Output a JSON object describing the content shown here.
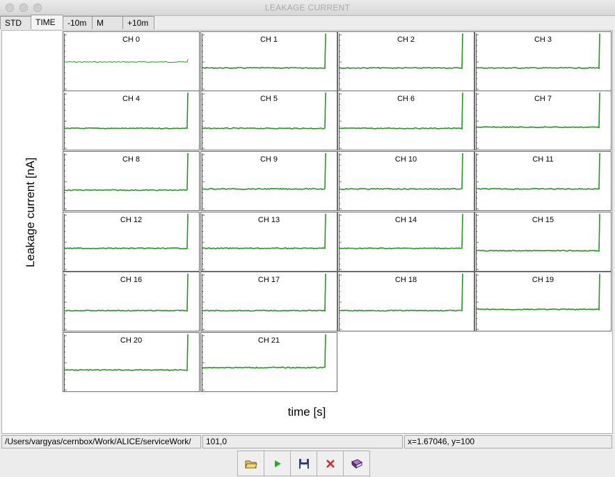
{
  "window": {
    "title": "LEAKAGE CURRENT"
  },
  "tabs": [
    {
      "label": "STD",
      "active": false
    },
    {
      "label": "TIME",
      "active": true
    },
    {
      "label": "-10m",
      "active": false
    },
    {
      "label": "M",
      "active": false
    },
    {
      "label": "+10m",
      "active": false
    }
  ],
  "plot": {
    "ylabel": "Leakage current [nA]",
    "xlabel": "time [s]",
    "trace_color": "#1f9a1f"
  },
  "chart_data": {
    "type": "line",
    "series": [
      {
        "name": "CH 0",
        "level": 0.5
      },
      {
        "name": "CH 1",
        "level": 0.4
      },
      {
        "name": "CH 2",
        "level": 0.4
      },
      {
        "name": "CH 3",
        "level": 0.4
      },
      {
        "name": "CH 4",
        "level": 0.38
      },
      {
        "name": "CH 5",
        "level": 0.38
      },
      {
        "name": "CH 6",
        "level": 0.38
      },
      {
        "name": "CH 7",
        "level": 0.4
      },
      {
        "name": "CH 8",
        "level": 0.36
      },
      {
        "name": "CH 9",
        "level": 0.38
      },
      {
        "name": "CH 10",
        "level": 0.38
      },
      {
        "name": "CH 11",
        "level": 0.38
      },
      {
        "name": "CH 12",
        "level": 0.4
      },
      {
        "name": "CH 13",
        "level": 0.4
      },
      {
        "name": "CH 14",
        "level": 0.4
      },
      {
        "name": "CH 15",
        "level": 0.36
      },
      {
        "name": "CH 16",
        "level": 0.36
      },
      {
        "name": "CH 17",
        "level": 0.36
      },
      {
        "name": "CH 18",
        "level": 0.36
      },
      {
        "name": "CH 19",
        "level": 0.38
      },
      {
        "name": "CH 20",
        "level": 0.38
      },
      {
        "name": "CH 21",
        "level": 0.42
      }
    ]
  },
  "status": {
    "path": "/Users/vargyas/cernbox/Work/ALICE/serviceWork/",
    "cursor_value": "101,0",
    "coords": "x=1.67046, y=100"
  },
  "toolbar": {
    "buttons": [
      {
        "name": "open-folder-icon",
        "color": "#c9a33a"
      },
      {
        "name": "play-icon",
        "color": "#22b022"
      },
      {
        "name": "save-icon",
        "color": "#2a3f8f"
      },
      {
        "name": "close-icon",
        "color": "#e02020"
      },
      {
        "name": "book-icon",
        "color": "#8a3fa0"
      }
    ]
  }
}
